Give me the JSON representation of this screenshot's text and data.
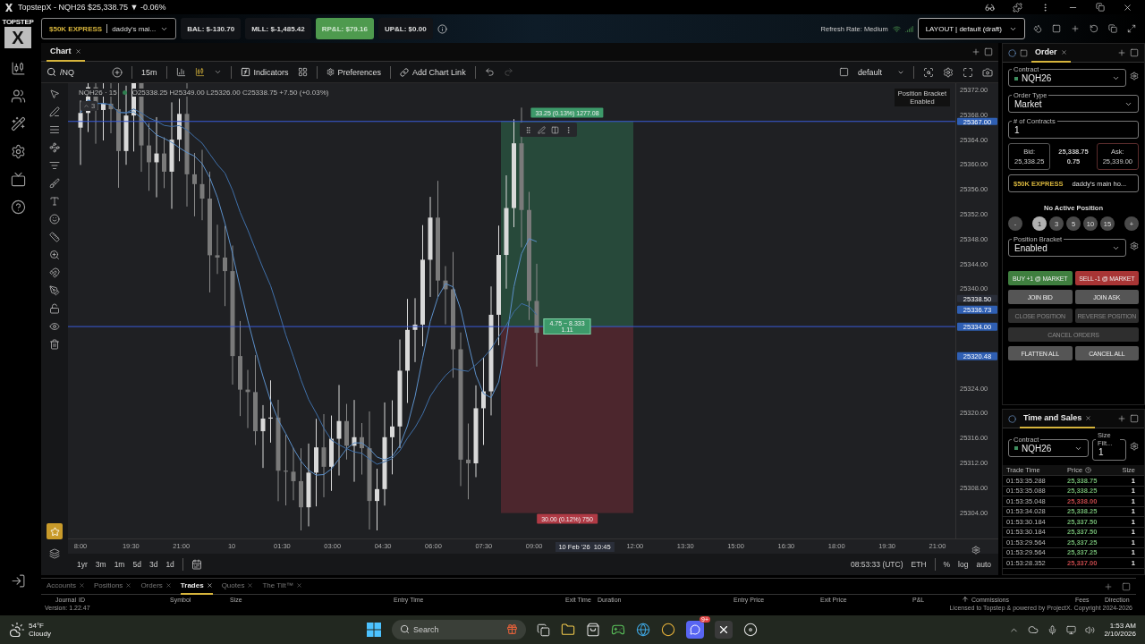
{
  "window": {
    "title": "TopstepX - NQH26 $25,338.75 ▼ -0.06%"
  },
  "logo": {
    "top": "TOPSTEP",
    "mark": "X"
  },
  "header": {
    "account": {
      "tier": "$50K EXPRESS",
      "name": "daddy's mai..."
    },
    "stats": [
      {
        "label": "BAL: $-130.70",
        "highlight": false
      },
      {
        "label": "MLL: $-1,485.42",
        "highlight": false
      },
      {
        "label": "RP&L: $79.16",
        "highlight": true
      },
      {
        "label": "UP&L: $0.00",
        "highlight": false
      }
    ],
    "refresh": "Refresh Rate: Medium",
    "layout": "LAYOUT | default (draft)"
  },
  "chart": {
    "tab": "Chart",
    "symbol": "/NQ",
    "interval": "15m",
    "indicators": "Indicators",
    "preferences": "Preferences",
    "chart_link": "Add Chart Link",
    "template": "default",
    "legend": {
      "title": "NQH26 · 15",
      "ohlc": "O25338.25 H25349.00 L25326.00 C25338.75 +7.50 (+0.03%)",
      "collapsed": "3"
    },
    "bracket_badge": {
      "title": "Position Bracket",
      "state": "Enabled"
    },
    "price_ticks": [
      "25372.00",
      "25368.00",
      "25364.00",
      "25360.00",
      "25356.00",
      "25352.00",
      "25348.00",
      "25344.00",
      "25340.00",
      "25324.00",
      "25320.00",
      "25316.00",
      "25312.00",
      "25308.00",
      "25304.00"
    ],
    "price_markers": [
      {
        "label": "25367.00",
        "kind": "price",
        "color": "#2f5fb3"
      },
      {
        "label": "25338.50",
        "kind": "price",
        "color": "#2a2e39"
      },
      {
        "label": "25336.73",
        "kind": "price",
        "color": "#2f5fb3"
      },
      {
        "label": "25334.00",
        "kind": "price",
        "color": "#2f5fb3"
      },
      {
        "label": "25320.48",
        "kind": "indicator",
        "color": "#2f5fb3"
      }
    ],
    "position": {
      "target": "33.25 (0.13%) 1277.08",
      "ratio": "4.75 ~ 8.333",
      "ratio_value": "1.11",
      "stop": "30.00 (0.12%) 750"
    },
    "time_labels": [
      {
        "label": "8:00",
        "kind": "tick"
      },
      {
        "label": "19:30",
        "kind": "tick"
      },
      {
        "label": "21:00",
        "kind": "tick"
      },
      {
        "label": "10",
        "kind": "tick"
      },
      {
        "label": "01:30",
        "kind": "tick"
      },
      {
        "label": "03:00",
        "kind": "tick"
      },
      {
        "label": "04:30",
        "kind": "tick"
      },
      {
        "label": "06:00",
        "kind": "tick"
      },
      {
        "label": "07:30",
        "kind": "tick"
      },
      {
        "label": "09:00",
        "kind": "tick"
      },
      {
        "label": "10 Feb '26  10:45",
        "kind": "cursor"
      },
      {
        "label": "12:00",
        "kind": "tick"
      },
      {
        "label": "13:30",
        "kind": "tick"
      },
      {
        "label": "15:00",
        "kind": "tick"
      },
      {
        "label": "16:30",
        "kind": "tick"
      },
      {
        "label": "18:00",
        "kind": "tick"
      },
      {
        "label": "19:30",
        "kind": "tick"
      },
      {
        "label": "21:00",
        "kind": "tick"
      }
    ],
    "ranges": [
      "1yr",
      "3m",
      "1m",
      "5d",
      "3d",
      "1d"
    ],
    "status": {
      "clock": "08:53:33 (UTC)",
      "session": "ETH",
      "percent": "%",
      "log": "log",
      "auto": "auto"
    }
  },
  "order": {
    "title": "Order",
    "contract_label": "Contract",
    "contract": "NQH26",
    "order_type_label": "Order Type",
    "order_type": "Market",
    "contracts_label": "# of Contracts",
    "contracts": "1",
    "quote": {
      "bid_label": "Bid:",
      "bid": "25,338.25",
      "last": "25,338.75",
      "spread": "0.75",
      "ask_label": "Ask:",
      "ask": "25,339.00"
    },
    "account": {
      "tier": "$50K EXPRESS",
      "name": "daddy's main ho..."
    },
    "position_status": "No Active Position",
    "quantities": [
      {
        "label": "-",
        "kind": "step",
        "selected": false
      },
      {
        "label": "1",
        "kind": "qty",
        "selected": true
      },
      {
        "label": "3",
        "kind": "qty",
        "selected": false
      },
      {
        "label": "5",
        "kind": "qty",
        "selected": false
      },
      {
        "label": "10",
        "kind": "qty",
        "selected": false
      },
      {
        "label": "15",
        "kind": "qty",
        "selected": false
      },
      {
        "label": "+",
        "kind": "step",
        "selected": false
      }
    ],
    "bracket_label": "Position Bracket",
    "bracket": "Enabled",
    "action_rows": [
      [
        {
          "label": "BUY +1 @ MARKET",
          "kind": "buy",
          "disabled": false
        },
        {
          "label": "SELL -1 @ MARKET",
          "kind": "sell",
          "disabled": false
        }
      ],
      [
        {
          "label": "JOIN BID",
          "kind": "plain",
          "disabled": false
        },
        {
          "label": "JOIN ASK",
          "kind": "plain",
          "disabled": false
        }
      ],
      [
        {
          "label": "CLOSE POSITION",
          "kind": "plain",
          "disabled": true
        },
        {
          "label": "REVERSE POSITION",
          "kind": "plain",
          "disabled": true
        }
      ],
      [
        {
          "label": "CANCEL ORDERS",
          "kind": "plain",
          "disabled": true
        }
      ],
      [
        {
          "label": "FLATTEN ALL",
          "kind": "plain",
          "disabled": false
        },
        {
          "label": "CANCEL ALL",
          "kind": "plain",
          "disabled": false
        }
      ]
    ]
  },
  "time_sales": {
    "title": "Time and Sales",
    "contract_label": "Contract",
    "contract": "NQH26",
    "size_filter_label": "Size Filt...",
    "size_filter": "1",
    "columns": [
      "Trade Time",
      "Price",
      "Size"
    ],
    "rows": [
      {
        "time": "01:53:35.288",
        "price": "25,338.75",
        "size": "1",
        "color": "#6fb36f"
      },
      {
        "time": "01:53:35.088",
        "price": "25,338.25",
        "size": "1",
        "color": "#6fb36f"
      },
      {
        "time": "01:53:35.048",
        "price": "25,338.00",
        "size": "1",
        "color": "#c0474a"
      },
      {
        "time": "01:53:34.028",
        "price": "25,338.25",
        "size": "1",
        "color": "#6fb36f"
      },
      {
        "time": "01:53:30.184",
        "price": "25,337.50",
        "size": "1",
        "color": "#6fb36f"
      },
      {
        "time": "01:53:30.184",
        "price": "25,337.50",
        "size": "1",
        "color": "#6fb36f"
      },
      {
        "time": "01:53:29.564",
        "price": "25,337.25",
        "size": "1",
        "color": "#6fb36f"
      },
      {
        "time": "01:53:29.564",
        "price": "25,337.25",
        "size": "1",
        "color": "#6fb36f"
      },
      {
        "time": "01:53:28.352",
        "price": "25,337.00",
        "size": "1",
        "color": "#c0474a"
      }
    ]
  },
  "bottom": {
    "tabs": [
      {
        "label": "Accounts",
        "selected": false
      },
      {
        "label": "Positions",
        "selected": false
      },
      {
        "label": "Orders",
        "selected": false
      },
      {
        "label": "Trades",
        "selected": true
      },
      {
        "label": "Quotes",
        "selected": false
      },
      {
        "label": "The Tilt™",
        "selected": false
      }
    ],
    "columns": [
      {
        "label": "Journal",
        "sorted": false
      },
      {
        "label": "ID",
        "sorted": false
      },
      {
        "label": "Symbol",
        "sorted": false
      },
      {
        "label": "Size",
        "sorted": false
      },
      {
        "label": "Entry Time",
        "sorted": false
      },
      {
        "label": "Exit Time",
        "sorted": false
      },
      {
        "label": "Duration",
        "sorted": false
      },
      {
        "label": "Entry Price",
        "sorted": false
      },
      {
        "label": "Exit Price",
        "sorted": false
      },
      {
        "label": "P&L",
        "sorted": false
      },
      {
        "label": "Commissions",
        "sorted": true
      },
      {
        "label": "Fees",
        "sorted": false
      },
      {
        "label": "Direction",
        "sorted": false
      }
    ],
    "version": "Version: 1.22.47",
    "license": "Licensed to Topstep & powered by ProjectX. Copyright 2024-2026"
  },
  "taskbar": {
    "weather": {
      "temp": "54°F",
      "condition": "Cloudy"
    },
    "search_placeholder": "Search",
    "discord_badge": "9+",
    "clock": {
      "time": "1:53 AM",
      "date": "2/10/2026"
    }
  }
}
